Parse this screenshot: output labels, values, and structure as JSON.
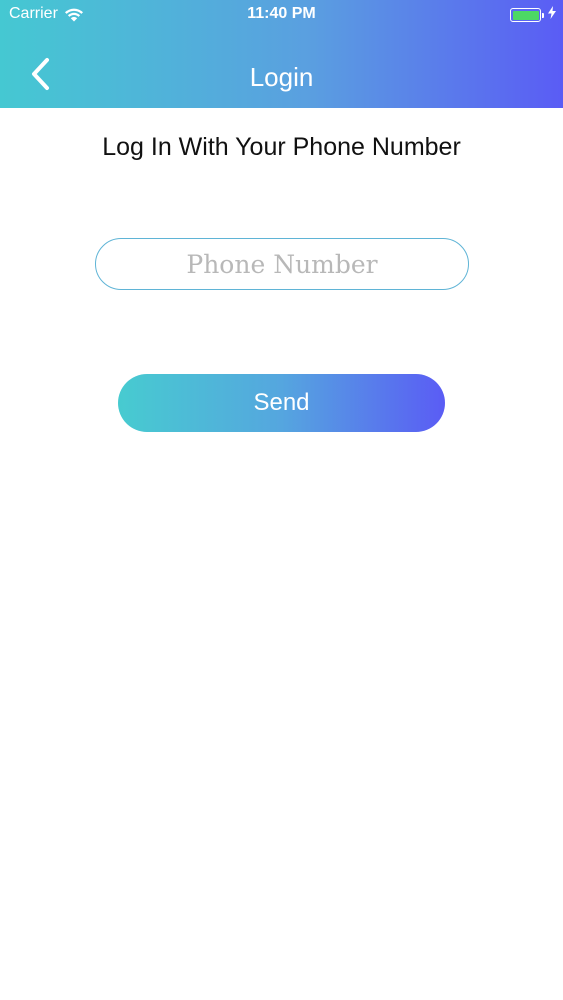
{
  "status_bar": {
    "carrier": "Carrier",
    "time": "11:40 PM",
    "wifi_icon": "wifi-icon",
    "battery_icon": "battery-icon",
    "charging_icon": "charging-bolt-icon",
    "battery_color": "#4cd964"
  },
  "nav": {
    "title": "Login",
    "back_icon": "chevron-left-icon"
  },
  "content": {
    "heading": "Log In With Your Phone Number",
    "phone_input": {
      "value": "",
      "placeholder": "Phone Number"
    },
    "send_label": "Send"
  },
  "colors": {
    "gradient_start": "#45c8d2",
    "gradient_end": "#5a5cf5",
    "input_border": "#5fb4d6"
  }
}
